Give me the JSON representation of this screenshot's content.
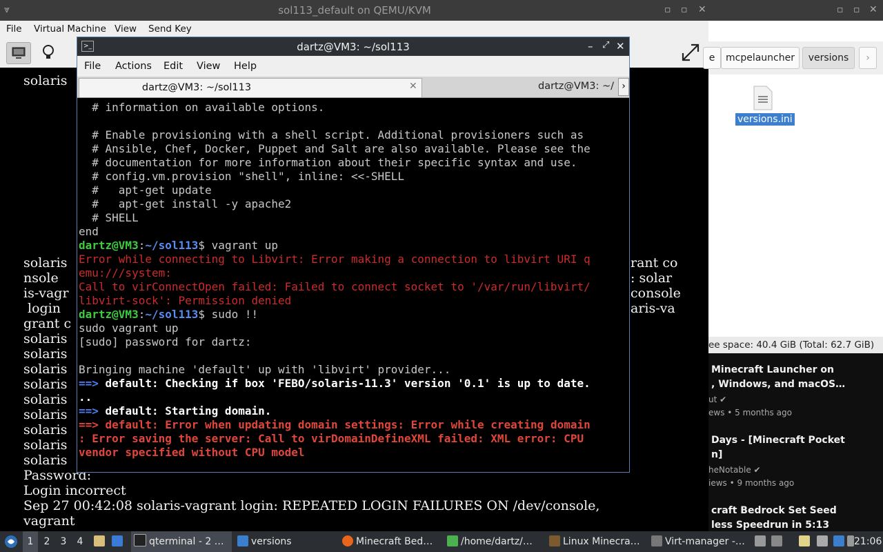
{
  "vm_window": {
    "title": "sol113_default on QEMU/KVM",
    "menu": [
      "File",
      "Virtual Machine",
      "View",
      "Send Key"
    ]
  },
  "console": {
    "lines_top": [
      "solaris"
    ],
    "left_fragments": [
      "solaris",
      "nsole",
      "is-vagr",
      " login",
      "grant c",
      "solaris",
      "solaris",
      "solaris",
      "solaris",
      "solaris",
      "..",
      "solaris",
      "solaris",
      "solaris",
      "solaris"
    ],
    "right_fragments": [
      "rant co",
      ": solar",
      "console",
      "aris-va"
    ],
    "bottom_lines": [
      "Password:",
      "Login incorrect",
      "Sep 27 00:42:08 solaris-vagrant login: REPEATED LOGIN FAILURES ON /dev/console,",
      "vagrant"
    ]
  },
  "right_panel": {
    "tabs": [
      "e",
      "mcpelauncher",
      "versions"
    ],
    "file_name": "versions.ini",
    "status": "ee space: 40.4 GiB (Total: 62.7 GiB)",
    "videos": [
      {
        "title1": "Minecraft Launcher on",
        "title2": ", Windows, and macOS…",
        "channel": "ut",
        "meta": "ews • 5 months ago"
      },
      {
        "title1": "Days - [Minecraft Pocket",
        "title2": "n]",
        "channel": "heNotable",
        "meta": "iews • 9 months ago"
      },
      {
        "title1": "craft Bedrock Set Seed",
        "title2": "less Speedrun in 5:13",
        "channel": "",
        "meta": ""
      }
    ]
  },
  "terminal": {
    "title": "dartz@VM3: ~/sol113",
    "menu": [
      "File",
      "Actions",
      "Edit",
      "View",
      "Help"
    ],
    "tab_active": "dartz@VM3: ~/sol113",
    "tab_inactive": "dartz@VM3: ~/",
    "prompt_user": "dartz@VM3",
    "prompt_sep": ":",
    "prompt_path": "~/sol113",
    "lines": {
      "l1": "  # information on available options.",
      "l2": "",
      "l3": "  # Enable provisioning with a shell script. Additional provisioners such as",
      "l4": "  # Ansible, Chef, Docker, Puppet and Salt are also available. Please see the",
      "l5": "  # documentation for more information about their specific syntax and use.",
      "l6": "  # config.vm.provision \"shell\", inline: <<-SHELL",
      "l7": "  #   apt-get update",
      "l8": "  #   apt-get install -y apache2",
      "l9": "  # SHELL",
      "l10": "end",
      "cmd1": "$ vagrant up",
      "err1": "Error while connecting to Libvirt: Error making a connection to libvirt URI q",
      "err2": "emu:///system:",
      "err3": "Call to virConnectOpen failed: Failed to connect socket to '/var/run/libvirt/",
      "err4": "libvirt-sock': Permission denied",
      "cmd2": "$ sudo !!",
      "l17": "sudo vagrant up",
      "l18": "[sudo] password for dartz:",
      "l20": "Bringing machine 'default' up with 'libvirt' provider...",
      "arrow": "==>",
      "l21": " default: Checking if box 'FEBO/solaris-11.3' version '0.1' is up to date.",
      "l22": "..",
      "l23": " default: Starting domain.",
      "l24": " default: Error when updating domain settings: Error while creating domain",
      "l25": ": Error saving the server: Call to virDomainDefineXML failed: XML error: CPU",
      "l26": "vendor specified without CPU model"
    }
  },
  "taskbar": {
    "workspaces": [
      "1",
      "2",
      "3",
      "4"
    ],
    "items": [
      "qterminal - 2 …",
      "versions",
      "Minecraft Bed…",
      "/home/dartz/…",
      "Linux Minecra…",
      "Virt-manager -…"
    ],
    "clock": "21:06"
  }
}
